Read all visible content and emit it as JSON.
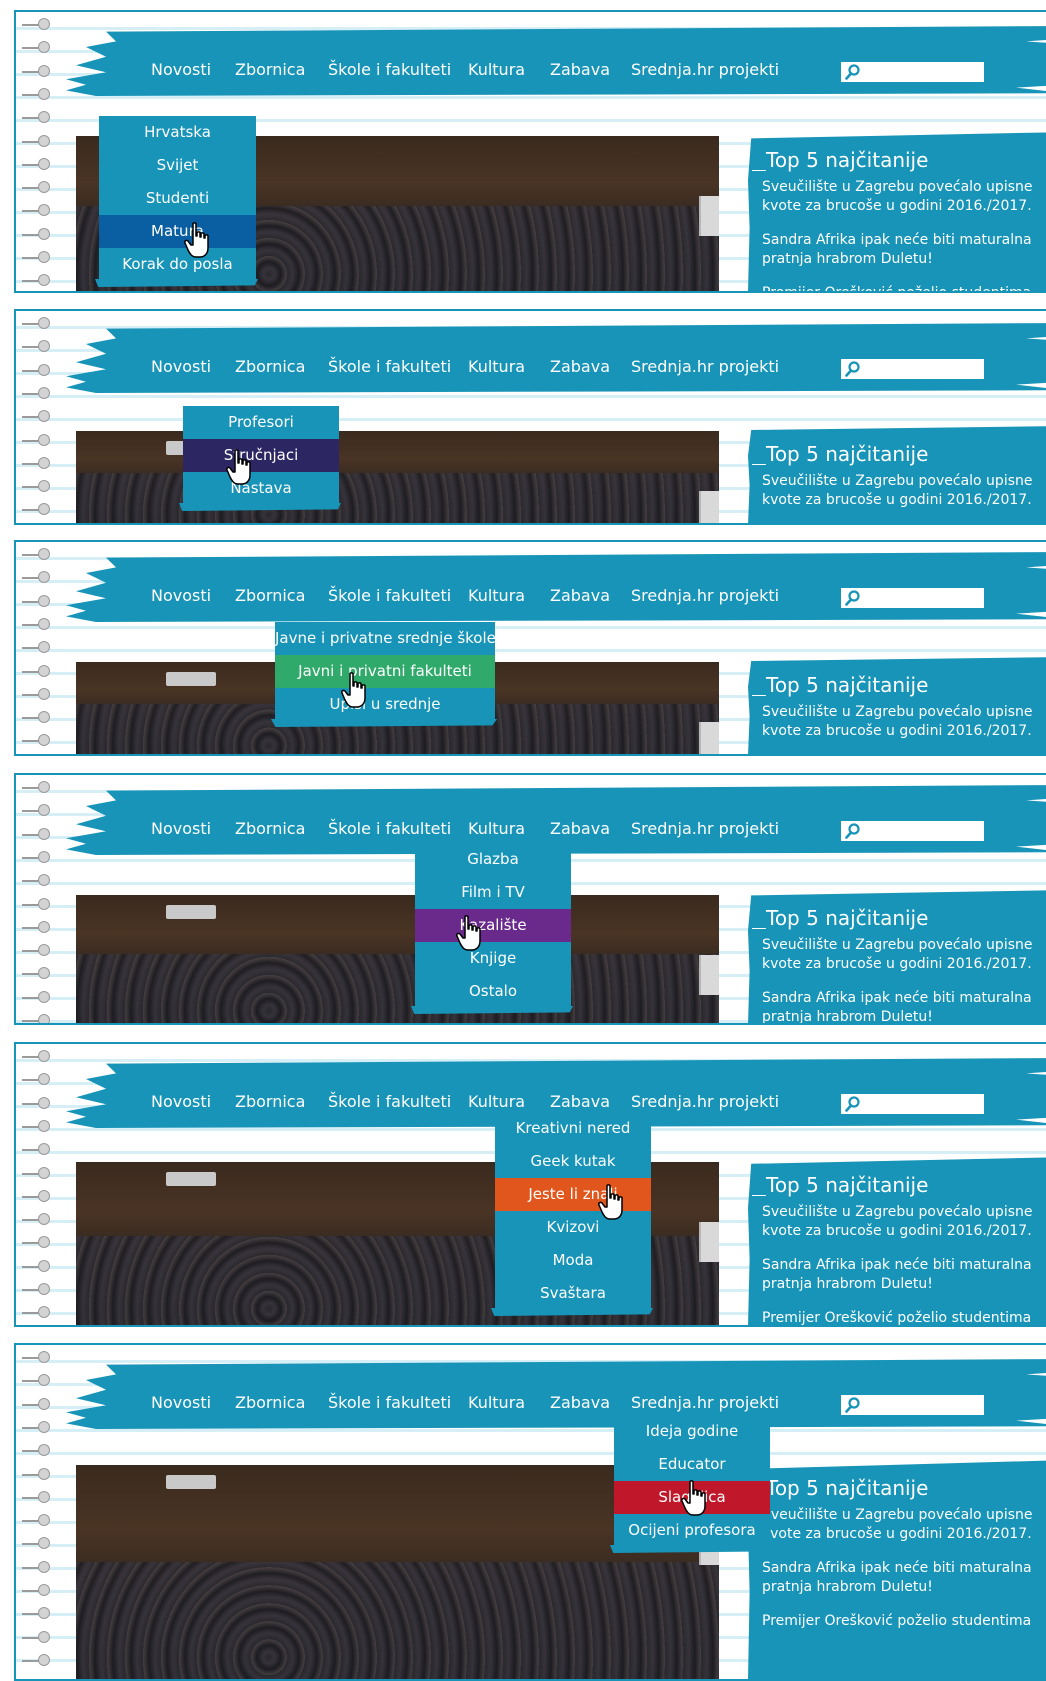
{
  "nav": {
    "items": [
      "Novosti",
      "Zbornica",
      "Škole i fakulteti",
      "Kultura",
      "Zabava",
      "Srednja.hr projekti"
    ],
    "search_placeholder": ""
  },
  "sidebar": {
    "title": "Top 5 najčitanije",
    "articles": [
      "Sveučilište u Zagrebu povećalo upisne kvote za brucoše u godini 2016./2017.",
      "Sandra Afrika ipak neće biti maturalna pratnja hrabrom Duletu!",
      "Premijer Orešković poželio studentima"
    ]
  },
  "panels": [
    {
      "open_menu": "Novosti",
      "dropdown": {
        "items": [
          "Hrvatska",
          "Svijet",
          "Studenti",
          "Matura",
          "Korak do posla"
        ],
        "hovered_index": 3,
        "hover_color": "#0a5fa3"
      }
    },
    {
      "open_menu": "Zbornica",
      "dropdown": {
        "items": [
          "Profesori",
          "Stručnjaci",
          "Nastava"
        ],
        "hovered_index": 1,
        "hover_color": "#2c2763"
      }
    },
    {
      "open_menu": "Škole i fakulteti",
      "dropdown": {
        "items": [
          "Javne i privatne srednje škole",
          "Javni i privatni fakulteti",
          "Upisi u srednje"
        ],
        "hovered_index": 1,
        "hover_color": "#2faa6a"
      }
    },
    {
      "open_menu": "Kultura",
      "dropdown": {
        "items": [
          "Glazba",
          "Film i TV",
          "Kazalište",
          "Knjige",
          "Ostalo"
        ],
        "hovered_index": 2,
        "hover_color": "#6a2a8c"
      }
    },
    {
      "open_menu": "Zabava",
      "dropdown": {
        "items": [
          "Kreativni nered",
          "Geek kutak",
          "Jeste li znali",
          "Kvizovi",
          "Moda",
          "Svaštara"
        ],
        "hovered_index": 2,
        "hover_color": "#e0561d"
      }
    },
    {
      "open_menu": "Srednja.hr projekti",
      "dropdown": {
        "items": [
          "Ideja godine",
          "Educator",
          "Slagalica",
          "Ocijeni profesora"
        ],
        "hovered_index": 2,
        "hover_color": "#c0182a"
      }
    }
  ],
  "colors": {
    "brand": "#1794b8",
    "text_on_brand": "#ffffff"
  },
  "icons": {
    "search": "magnifier-icon",
    "cursor": "hand-pointer-icon",
    "binding": "spiral-ring-icon"
  }
}
